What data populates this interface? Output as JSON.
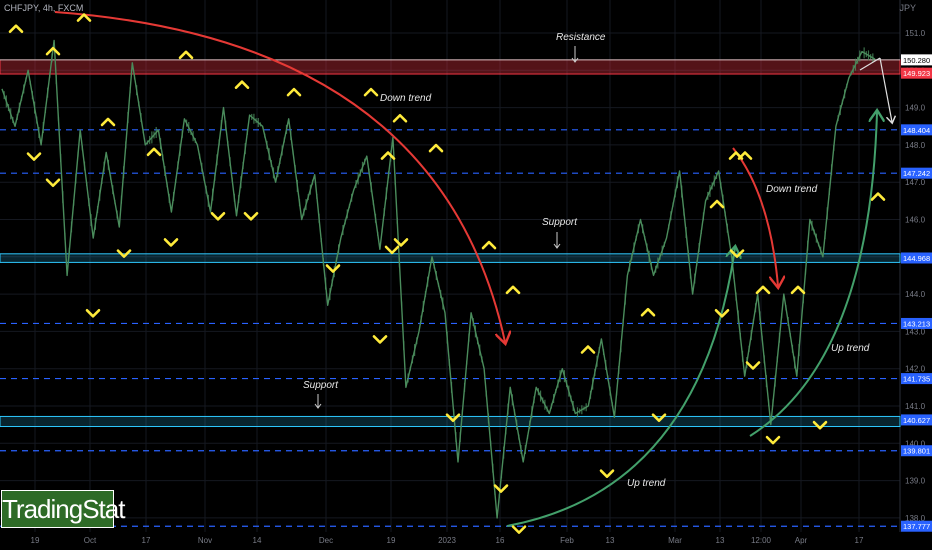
{
  "header": {
    "symbol": "CHFJPY, 4h, FXCM",
    "currency": "JPY"
  },
  "brand": {
    "label": "TradingStat"
  },
  "chart_data": {
    "type": "line",
    "ylim": [
      137.7,
      151.5
    ],
    "y_ticks": [
      138.0,
      139.0,
      140.0,
      141.0,
      142.0,
      143.0,
      144.0,
      145.0,
      146.0,
      147.0,
      148.0,
      149.0,
      150.0,
      151.0
    ],
    "x_ticks": [
      "19",
      "Oct",
      "17",
      "Nov",
      "14",
      "Dec",
      "19",
      "2023",
      "16",
      "Feb",
      "13",
      "Mar",
      "13",
      "12:00",
      "Apr",
      "17"
    ],
    "price_labels": [
      {
        "value": 150.28,
        "label": "150.280",
        "bg": "#ffffff",
        "fg": "#000000"
      },
      {
        "value": 149.923,
        "label": "149.923",
        "bg": "#f23645",
        "fg": "#ffffff"
      },
      {
        "value": 148.404,
        "label": "148.404",
        "bg": "#2962ff",
        "fg": "#ffffff"
      },
      {
        "value": 147.242,
        "label": "147.242",
        "bg": "#2962ff",
        "fg": "#ffffff"
      },
      {
        "value": 144.968,
        "label": "144.968",
        "bg": "#2962ff",
        "fg": "#ffffff"
      },
      {
        "value": 143.213,
        "label": "143.213",
        "bg": "#2962ff",
        "fg": "#ffffff"
      },
      {
        "value": 141.735,
        "label": "141.735",
        "bg": "#2962ff",
        "fg": "#ffffff"
      },
      {
        "value": 140.627,
        "label": "140.627",
        "bg": "#2962ff",
        "fg": "#ffffff"
      },
      {
        "value": 139.801,
        "label": "139.801",
        "bg": "#2962ff",
        "fg": "#ffffff"
      },
      {
        "value": 137.777,
        "label": "137.777",
        "bg": "#2962ff",
        "fg": "#ffffff"
      }
    ],
    "dashed_levels": [
      148.404,
      147.242,
      143.213,
      141.735,
      139.801,
      137.777
    ],
    "zones": [
      {
        "kind": "resistance",
        "from": 149.9,
        "to": 150.28,
        "color": "#f23645"
      },
      {
        "kind": "support",
        "from": 144.85,
        "to": 145.08,
        "color": "#2ec8ff"
      },
      {
        "kind": "support",
        "from": 140.45,
        "to": 140.72,
        "color": "#2ec8ff"
      }
    ],
    "price_path": [
      [
        "19",
        149.5
      ],
      [
        "19",
        148.5
      ],
      [
        "19",
        150.0
      ],
      [
        "19",
        148.0
      ],
      [
        "19",
        150.8
      ],
      [
        "Oct",
        144.5
      ],
      [
        "Oct",
        148.4
      ],
      [
        "Oct",
        145.5
      ],
      [
        "Oct",
        147.8
      ],
      [
        "Oct",
        145.8
      ],
      [
        "17",
        150.2
      ],
      [
        "17",
        148.0
      ],
      [
        "17",
        148.4
      ],
      [
        "17",
        146.2
      ],
      [
        "17",
        148.7
      ],
      [
        "Nov",
        148.0
      ],
      [
        "Nov",
        146.2
      ],
      [
        "Nov",
        149.0
      ],
      [
        "Nov",
        146.1
      ],
      [
        "Nov",
        148.8
      ],
      [
        "14",
        148.5
      ],
      [
        "14",
        147.0
      ],
      [
        "14",
        148.7
      ],
      [
        "14",
        146.0
      ],
      [
        "14",
        147.2
      ],
      [
        "Dec",
        143.7
      ],
      [
        "Dec",
        145.5
      ],
      [
        "Dec",
        146.8
      ],
      [
        "Dec",
        147.7
      ],
      [
        "Dec",
        145.2
      ],
      [
        "19",
        148.2
      ],
      [
        "19",
        141.5
      ],
      [
        "19",
        143.0
      ],
      [
        "19",
        145.0
      ],
      [
        "19",
        143.5
      ],
      [
        "2023",
        139.5
      ],
      [
        "2023",
        143.5
      ],
      [
        "2023",
        142.0
      ],
      [
        "2023",
        138.0
      ],
      [
        "2023",
        141.5
      ],
      [
        "16",
        139.5
      ],
      [
        "16",
        141.5
      ],
      [
        "16",
        140.8
      ],
      [
        "16",
        142.0
      ],
      [
        "16",
        140.8
      ],
      [
        "Feb",
        141.0
      ],
      [
        "Feb",
        142.8
      ],
      [
        "Feb",
        140.7
      ],
      [
        "Feb",
        144.5
      ],
      [
        "Feb",
        146.0
      ],
      [
        "13",
        144.5
      ],
      [
        "13",
        145.5
      ],
      [
        "13",
        147.3
      ],
      [
        "13",
        144.0
      ],
      [
        "13",
        146.5
      ],
      [
        "Mar",
        147.3
      ],
      [
        "Mar",
        145.0
      ],
      [
        "Mar",
        141.8
      ],
      [
        "Mar",
        144.0
      ],
      [
        "Mar",
        140.5
      ],
      [
        "13",
        144.0
      ],
      [
        "13",
        141.8
      ],
      [
        "13",
        146.0
      ],
      [
        "13",
        145.0
      ],
      [
        "13",
        148.5
      ],
      [
        "12:00",
        149.8
      ],
      [
        "12:00",
        150.5
      ],
      [
        "12:00",
        150.3
      ]
    ],
    "swing_points": [
      {
        "type": "high",
        "value": 150.9
      },
      {
        "type": "low",
        "value": 147.9
      },
      {
        "type": "high",
        "value": 150.3
      },
      {
        "type": "low",
        "value": 147.2
      },
      {
        "type": "high",
        "value": 151.2
      },
      {
        "type": "low",
        "value": 143.7
      },
      {
        "type": "high",
        "value": 148.4
      },
      {
        "type": "low",
        "value": 145.3
      },
      {
        "type": "high",
        "value": 147.6
      },
      {
        "type": "low",
        "value": 145.6
      },
      {
        "type": "high",
        "value": 150.2
      },
      {
        "type": "low",
        "value": 146.3
      },
      {
        "type": "high",
        "value": 149.4
      },
      {
        "type": "low",
        "value": 146.3
      },
      {
        "type": "high",
        "value": 149.2
      },
      {
        "type": "low",
        "value": 144.9
      },
      {
        "type": "high",
        "value": 149.2
      },
      {
        "type": "low",
        "value": 143.0
      },
      {
        "type": "high",
        "value": 147.5
      },
      {
        "type": "low",
        "value": 145.4
      },
      {
        "type": "high",
        "value": 148.5
      },
      {
        "type": "low",
        "value": 145.6
      },
      {
        "type": "high",
        "value": 147.7
      },
      {
        "type": "low",
        "value": 140.9
      },
      {
        "type": "high",
        "value": 145.1
      },
      {
        "type": "low",
        "value": 139.0
      },
      {
        "type": "high",
        "value": 143.9
      },
      {
        "type": "low",
        "value": 137.9
      },
      {
        "type": "high",
        "value": 142.3
      },
      {
        "type": "low",
        "value": 139.4
      },
      {
        "type": "high",
        "value": 143.3
      },
      {
        "type": "low",
        "value": 140.9
      },
      {
        "type": "high",
        "value": 146.2
      },
      {
        "type": "low",
        "value": 143.7
      },
      {
        "type": "high",
        "value": 147.5
      },
      {
        "type": "low",
        "value": 145.3
      },
      {
        "type": "high",
        "value": 147.5
      },
      {
        "type": "low",
        "value": 142.3
      },
      {
        "type": "high",
        "value": 143.9
      },
      {
        "type": "low",
        "value": 140.3
      },
      {
        "type": "high",
        "value": 143.9
      },
      {
        "type": "low",
        "value": 140.7
      },
      {
        "type": "high",
        "value": 146.4
      },
      {
        "type": "low",
        "value": 144.1
      },
      {
        "type": "high",
        "value": 151.0
      }
    ],
    "annotations": {
      "resistance": "Resistance",
      "support_1": "Support",
      "support_2": "Support",
      "down_trend_1": "Down trend",
      "down_trend_2": "Down trend",
      "up_trend_1": "Up trend",
      "up_trend_2": "Up trend"
    },
    "colors": {
      "price": "#4a8c5c",
      "swing_marker": "#ffeb3b",
      "down_trend": "#e53935",
      "up_trend": "#43a06b",
      "dashed_level": "#2962ff"
    }
  }
}
